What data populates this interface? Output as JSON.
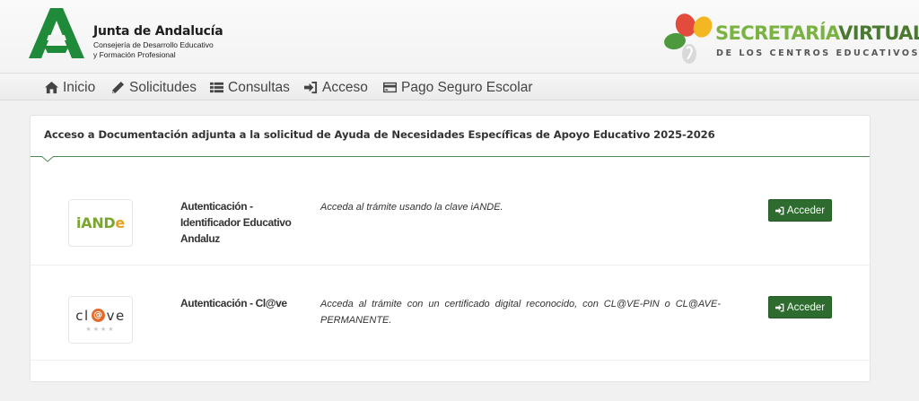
{
  "header": {
    "org_title": "Junta de Andalucía",
    "org_sub1": "Consejería de Desarrollo Educativo",
    "org_sub2": "y Formación Profesional",
    "brand_part1": "SECRETARÍA",
    "brand_part2": "VIRTUAL",
    "brand_sub": "DE LOS CENTROS EDUCATIVOS"
  },
  "nav": {
    "items": [
      {
        "label": "Inicio",
        "icon": "home-icon"
      },
      {
        "label": "Solicitudes",
        "icon": "pencil-icon"
      },
      {
        "label": "Consultas",
        "icon": "list-icon"
      },
      {
        "label": "Acceso",
        "icon": "sign-in-icon"
      },
      {
        "label": "Pago Seguro Escolar",
        "icon": "credit-card-icon"
      }
    ]
  },
  "panel": {
    "title": "Acceso a Documentación adjunta a la solicitud de Ayuda de Necesidades Específicas de Apoyo Educativo 2025-2026",
    "options": [
      {
        "logo_text_main": "iAND",
        "logo_text_accent": "e",
        "name": "Autenticación - Identificador Educativo Andaluz",
        "description": "Acceda al trámite usando la clave iANDE.",
        "button_label": "Acceder"
      },
      {
        "logo_text_pre": "cl",
        "logo_text_at": "@",
        "logo_text_post": "ve",
        "logo_stars": "★★★★",
        "name": "Autenticación - Cl@ve",
        "description": "Acceda al trámite con un certificado digital reconocido, con CL@VE-PIN o CL@AVE-PERMANENTE.",
        "button_label": "Acceder"
      }
    ]
  },
  "colors": {
    "primary_green": "#2e6b2e",
    "accent_line": "#4d8a52",
    "brand_light_green": "#7ab342",
    "brand_dark_green": "#4a7a2f"
  }
}
